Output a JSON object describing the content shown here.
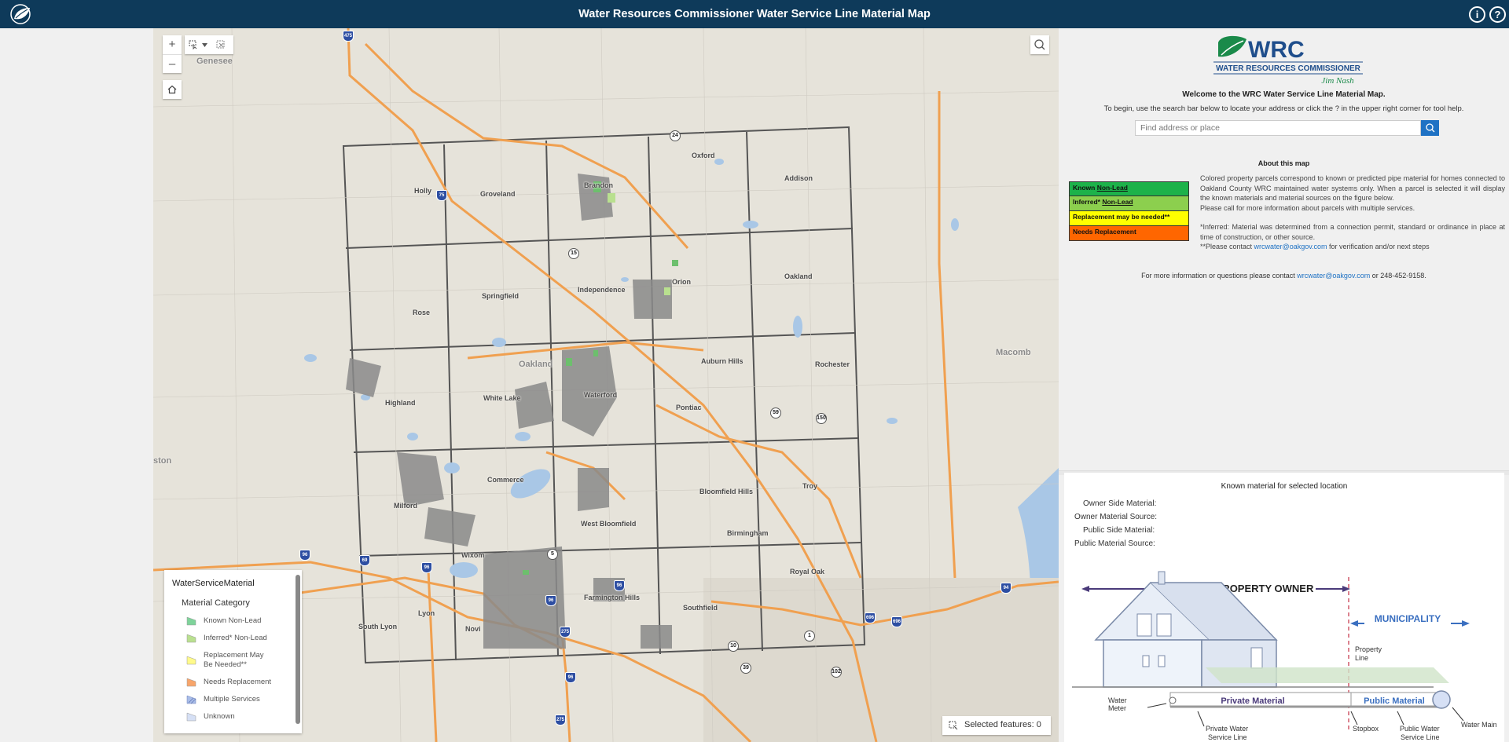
{
  "header": {
    "title": "Water Resources Commissioner Water Service Line Material Map",
    "info_icon": "info-icon",
    "help_icon": "help-icon",
    "info_glyph": "i",
    "help_glyph": "?"
  },
  "map": {
    "zoom_in": "+",
    "zoom_out": "–",
    "select_features_label": "Selected features: 0",
    "places": [
      {
        "name": "Genesee",
        "kind": "county"
      },
      {
        "name": "Oakland",
        "kind": "county"
      },
      {
        "name": "Macomb",
        "kind": "county"
      },
      {
        "name": "ston",
        "kind": "county"
      },
      {
        "name": "Holly"
      },
      {
        "name": "Groveland"
      },
      {
        "name": "Brandon"
      },
      {
        "name": "Oxford"
      },
      {
        "name": "Addison"
      },
      {
        "name": "Rose"
      },
      {
        "name": "Springfield"
      },
      {
        "name": "Independence"
      },
      {
        "name": "Orion"
      },
      {
        "name": "Oakland"
      },
      {
        "name": "Highland"
      },
      {
        "name": "White Lake"
      },
      {
        "name": "Waterford"
      },
      {
        "name": "Auburn Hills"
      },
      {
        "name": "Rochester"
      },
      {
        "name": "Pontiac"
      },
      {
        "name": "Milford"
      },
      {
        "name": "Commerce"
      },
      {
        "name": "West Bloomfield"
      },
      {
        "name": "Bloomfield Hills"
      },
      {
        "name": "Troy"
      },
      {
        "name": "Birmingham"
      },
      {
        "name": "Wixom"
      },
      {
        "name": "Royal Oak"
      },
      {
        "name": "South Lyon"
      },
      {
        "name": "Lyon"
      },
      {
        "name": "Novi"
      },
      {
        "name": "Farmington Hills"
      },
      {
        "name": "Southfield"
      }
    ],
    "route_shields": [
      "475",
      "24",
      "75",
      "15",
      "59",
      "150",
      "96",
      "69",
      "96",
      "5",
      "96",
      "96",
      "275",
      "275",
      "96",
      "10",
      "39",
      "1",
      "696",
      "696",
      "102",
      "94"
    ]
  },
  "legend": {
    "layer_title": "WaterServiceMaterial",
    "group_title": "Material Category",
    "items": [
      {
        "label": "Known Non-Lead",
        "color": "#7ed39a"
      },
      {
        "label": "Inferred* Non-Lead",
        "color": "#b9e08f"
      },
      {
        "label": "Replacement May Be Needed**",
        "color": "#fffa8a"
      },
      {
        "label": "Needs Replacement",
        "color": "#f7a56b"
      },
      {
        "label": "Multiple Services",
        "color": "#a9bde8"
      },
      {
        "label": "Unknown",
        "color": "#d6e0f5"
      }
    ]
  },
  "panel": {
    "logo_text": "WRC",
    "logo_sub": "WATER RESOURCES COMMISSIONER",
    "logo_name": "Jim Nash",
    "welcome": "Welcome to the WRC Water Service Line Material Map.",
    "begin": "To begin, use the search bar below to locate your address or click the ? in the upper right corner for tool help.",
    "search_placeholder": "Find address or place",
    "about_title": "About this map",
    "table": [
      {
        "prefix": "Known ",
        "underlined": "Non-Lead",
        "color": "#1db24a"
      },
      {
        "prefix": "Inferred* ",
        "underlined": "Non-Lead",
        "color": "#8ccf4e"
      },
      {
        "prefix": "Replacement may be needed**",
        "underlined": "",
        "color": "#ffff00"
      },
      {
        "prefix": "Needs Replacement",
        "underlined": "",
        "color": "#ff6600"
      }
    ],
    "desc1": "Colored property parcels correspond to known or predicted pipe material for homes connected to Oakland County WRC maintained water systems only. When a parcel is selected it will display the known materials and material sources on the figure below.",
    "desc2": "Please call for more information about parcels with multiple services.",
    "inferred_note": "*Inferred: Material was determined from a connection permit, standard or ordinance in place at time of construction, or other source.",
    "contact_prefix": "**Please contact ",
    "contact_email": "wrcwater@oakgov.com",
    "contact_suffix": " for verification and/or next steps",
    "more_prefix": "For more information or questions please contact ",
    "more_email": "wrcwater@oakgov.com",
    "more_suffix": " or 248-452-9158."
  },
  "known": {
    "title": "Known material for selected location",
    "rows": [
      "Owner Side Material:",
      "Owner Material Source:",
      "Public Side Material:",
      "Public Material Source:"
    ],
    "diagram": {
      "property_owner": "PROPERTY OWNER",
      "municipality": "MUNICIPALITY",
      "property_line": [
        "Property",
        "Line"
      ],
      "water_meter": [
        "Water",
        "Meter"
      ],
      "private_material": "Private Material",
      "public_material": "Public Material",
      "water_main": "Water Main",
      "private_service_line": [
        "Private Water",
        "Service Line"
      ],
      "stopbox": "Stopbox",
      "public_service_line": [
        "Public Water",
        "Service Line"
      ]
    }
  }
}
